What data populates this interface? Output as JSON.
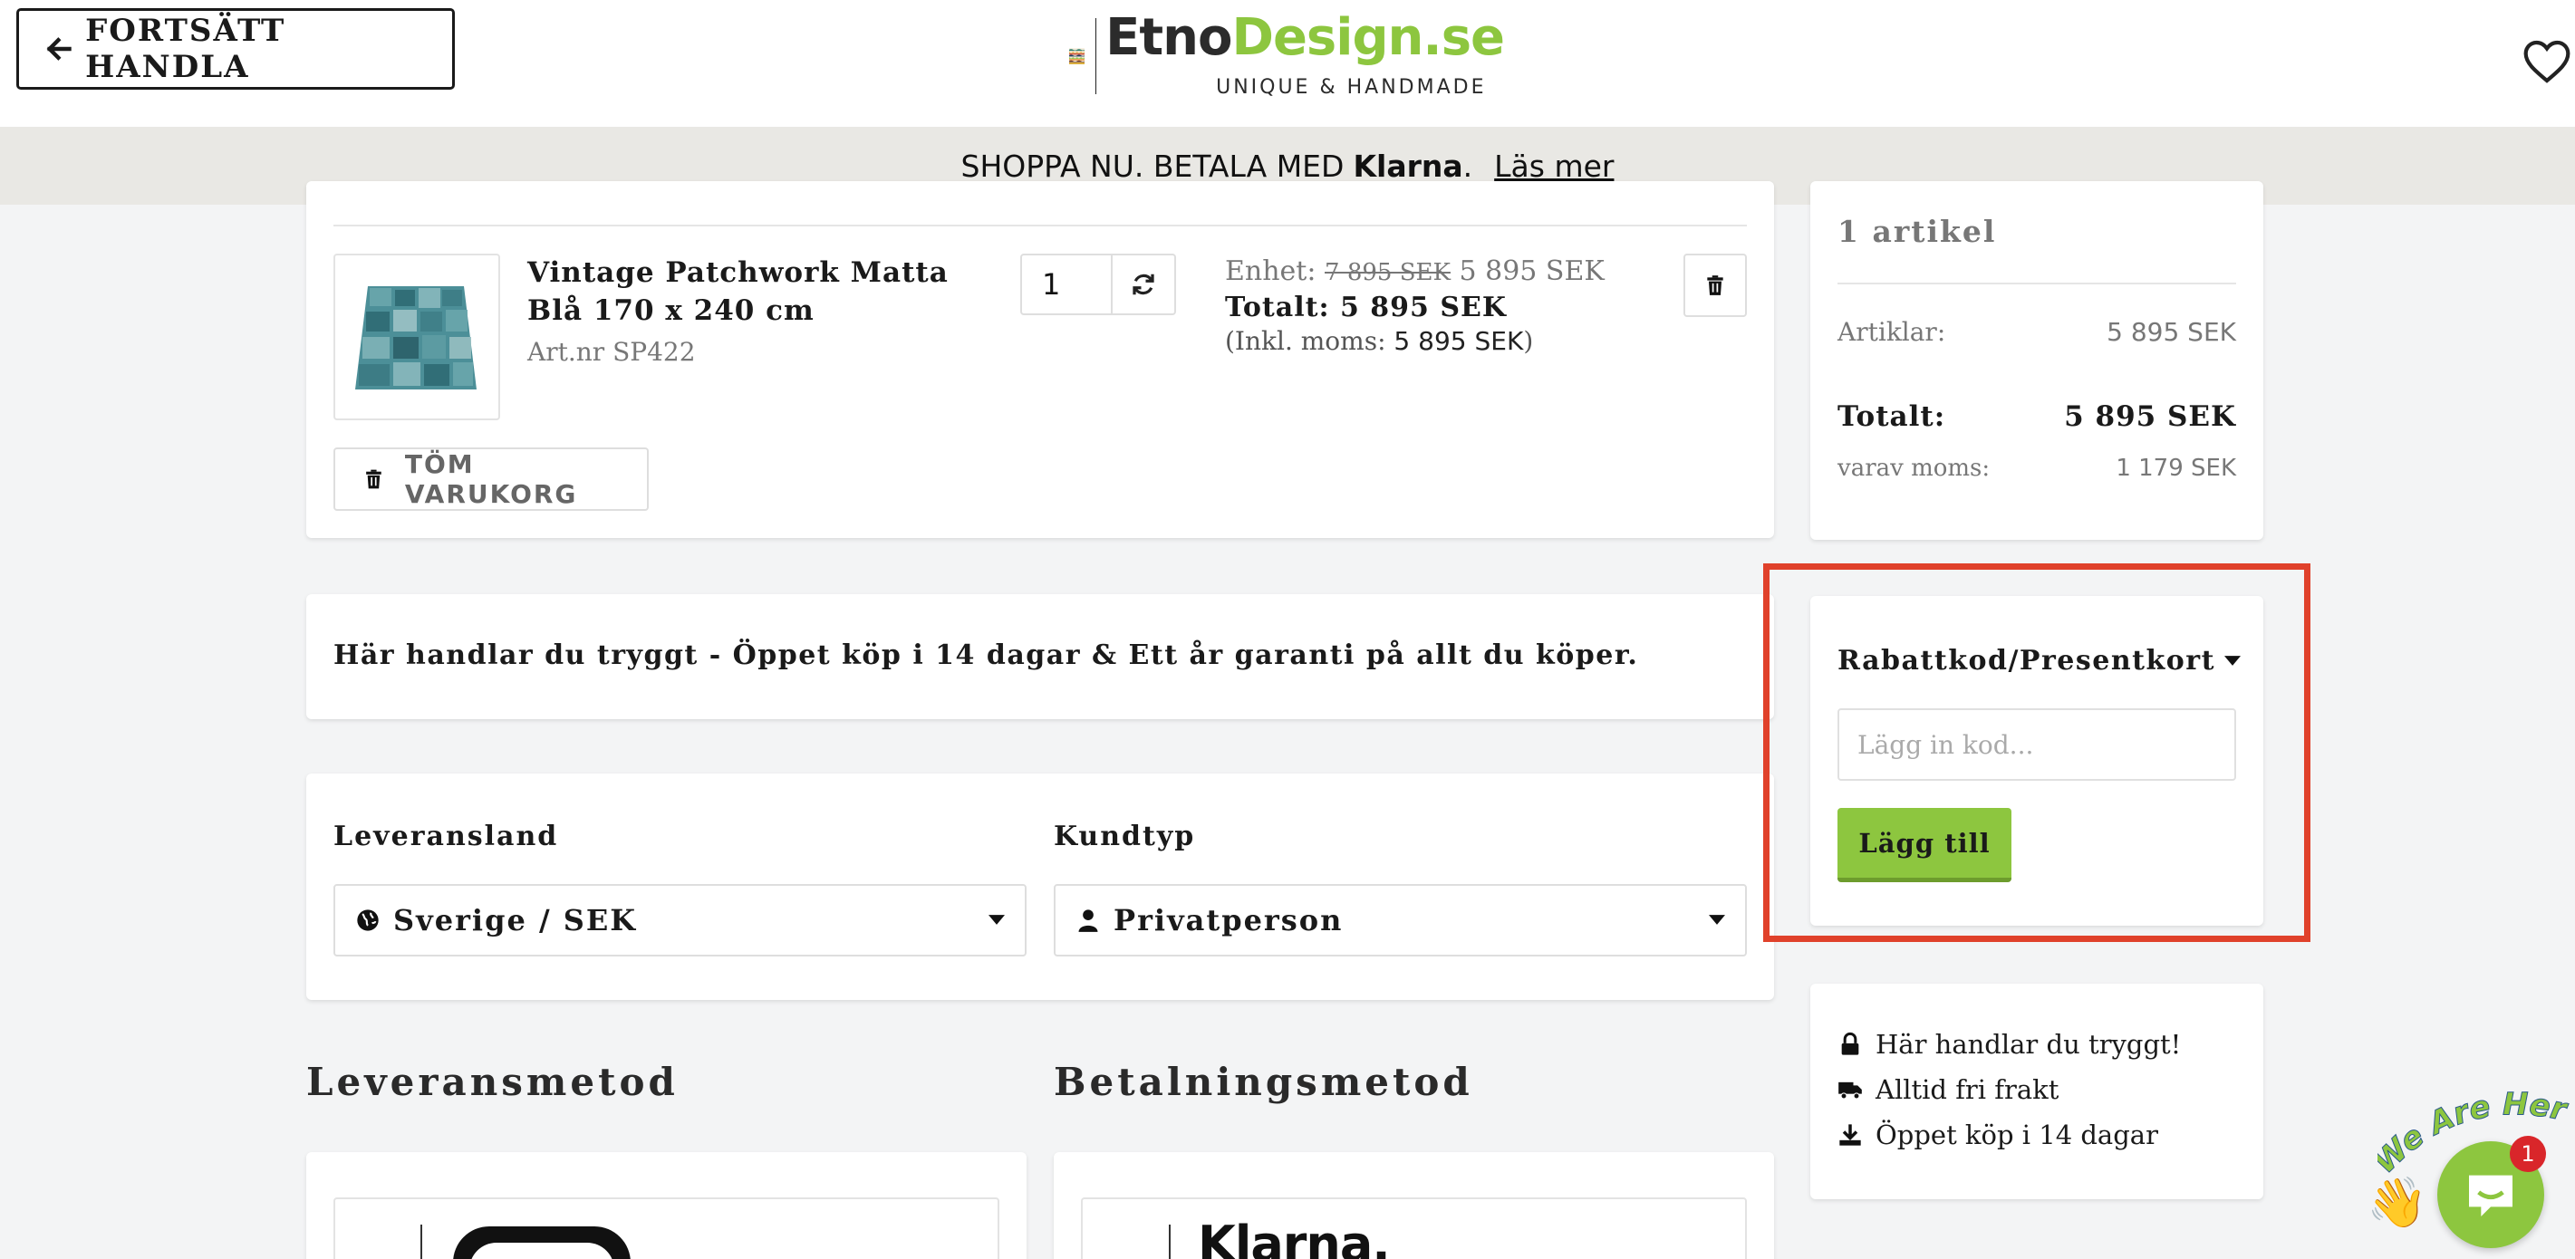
{
  "header": {
    "back_button_label": "FORTSÄTT HANDLA",
    "logo_name_part1": "Etno",
    "logo_name_part2": "Design.se",
    "logo_tagline": "UNIQUE & HANDMADE"
  },
  "banner": {
    "prefix": "SHOPPA NU. BETALA MED",
    "brand": "Klarna",
    "dot": ".",
    "link_label": "Läs mer"
  },
  "cart": {
    "item": {
      "name": "Vintage Patchwork Matta Blå 170 x 240 cm",
      "article": "Art.nr SP422",
      "quantity": "1",
      "unit_label": "Enhet:",
      "unit_old_price": "7 895 SEK",
      "unit_price": "5 895 SEK",
      "total_label": "Totalt:",
      "total_price": "5 895 SEK",
      "vat_prefix": "(Inkl. moms:",
      "vat_value": "5 895 SEK",
      "vat_suffix": ")"
    },
    "empty_button_label": "TÖM VARUKORG"
  },
  "trust_message": "Här handlar du tryggt - Öppet köp i 14 dagar & Ett år garanti på allt du köper.",
  "selectors": {
    "country_label": "Leveransland",
    "country_value": "Sverige / SEK",
    "customer_label": "Kundtyp",
    "customer_value": "Privatperson"
  },
  "sections": {
    "delivery_title": "Leveransmetod",
    "payment_title": "Betalningsmetod",
    "payment_logo": "Klarna."
  },
  "summary": {
    "count": "1 artikel",
    "items_label": "Artiklar:",
    "items_value": "5 895 SEK",
    "total_label": "Totalt:",
    "total_value": "5 895 SEK",
    "vat_label": "varav moms:",
    "vat_value": "1 179 SEK"
  },
  "coupon": {
    "label": "Rabattkod/Presentkort",
    "placeholder": "Lägg in kod...",
    "button_label": "Lägg till"
  },
  "safe_shopping": {
    "items": [
      "Här handlar du tryggt!",
      "Alltid fri frakt",
      "Öppet köp i 14 dagar"
    ]
  },
  "chat": {
    "badge_count": "1",
    "tagline": "We Are Here!"
  },
  "colors": {
    "brand_green": "#8dc63f",
    "highlight_red": "#e0412b",
    "banner_bg": "#e9e8e4",
    "page_bg": "#f3f4f5"
  }
}
